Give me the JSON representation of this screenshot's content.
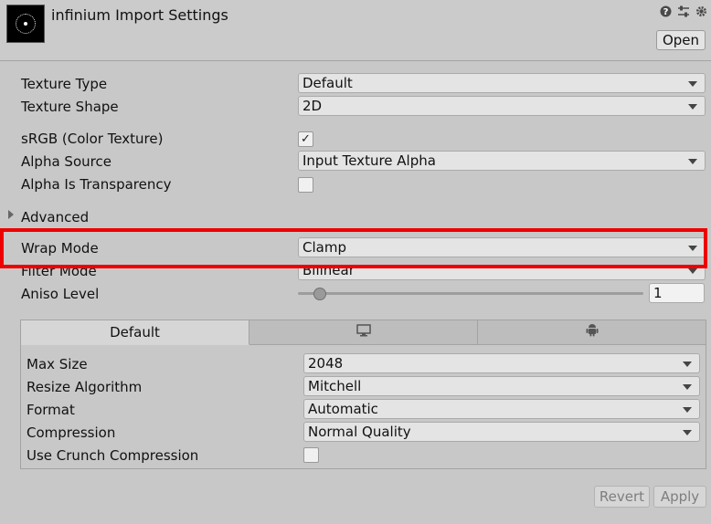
{
  "header": {
    "title": "infinium Import Settings",
    "open_button": "Open",
    "icons": [
      "help-icon",
      "preset-icon",
      "gear-icon"
    ]
  },
  "fields": {
    "texture_type": {
      "label": "Texture Type",
      "value": "Default"
    },
    "texture_shape": {
      "label": "Texture Shape",
      "value": "2D"
    },
    "srgb": {
      "label": "sRGB (Color Texture)",
      "checked": true,
      "check_glyph": "✓"
    },
    "alpha_source": {
      "label": "Alpha Source",
      "value": "Input Texture Alpha"
    },
    "alpha_transparency": {
      "label": "Alpha Is Transparency",
      "checked": false
    },
    "advanced": {
      "label": "Advanced"
    },
    "wrap_mode": {
      "label": "Wrap Mode",
      "value": "Clamp"
    },
    "filter_mode": {
      "label": "Filter Mode",
      "value": "Bilinear"
    },
    "aniso_level": {
      "label": "Aniso Level",
      "value": "1",
      "slider_fraction": 0.06
    }
  },
  "platform_tabs": {
    "default_label": "Default",
    "tab_icons": [
      "monitor-icon",
      "android-icon"
    ]
  },
  "platform_settings": {
    "max_size": {
      "label": "Max Size",
      "value": "2048"
    },
    "resize_algorithm": {
      "label": "Resize Algorithm",
      "value": "Mitchell"
    },
    "format": {
      "label": "Format",
      "value": "Automatic"
    },
    "compression": {
      "label": "Compression",
      "value": "Normal Quality"
    },
    "crunch": {
      "label": "Use Crunch Compression",
      "checked": false
    }
  },
  "footer": {
    "revert_button": "Revert",
    "apply_button": "Apply"
  },
  "colors": {
    "highlight": "#ee0000",
    "background": "#c8c8c8"
  }
}
